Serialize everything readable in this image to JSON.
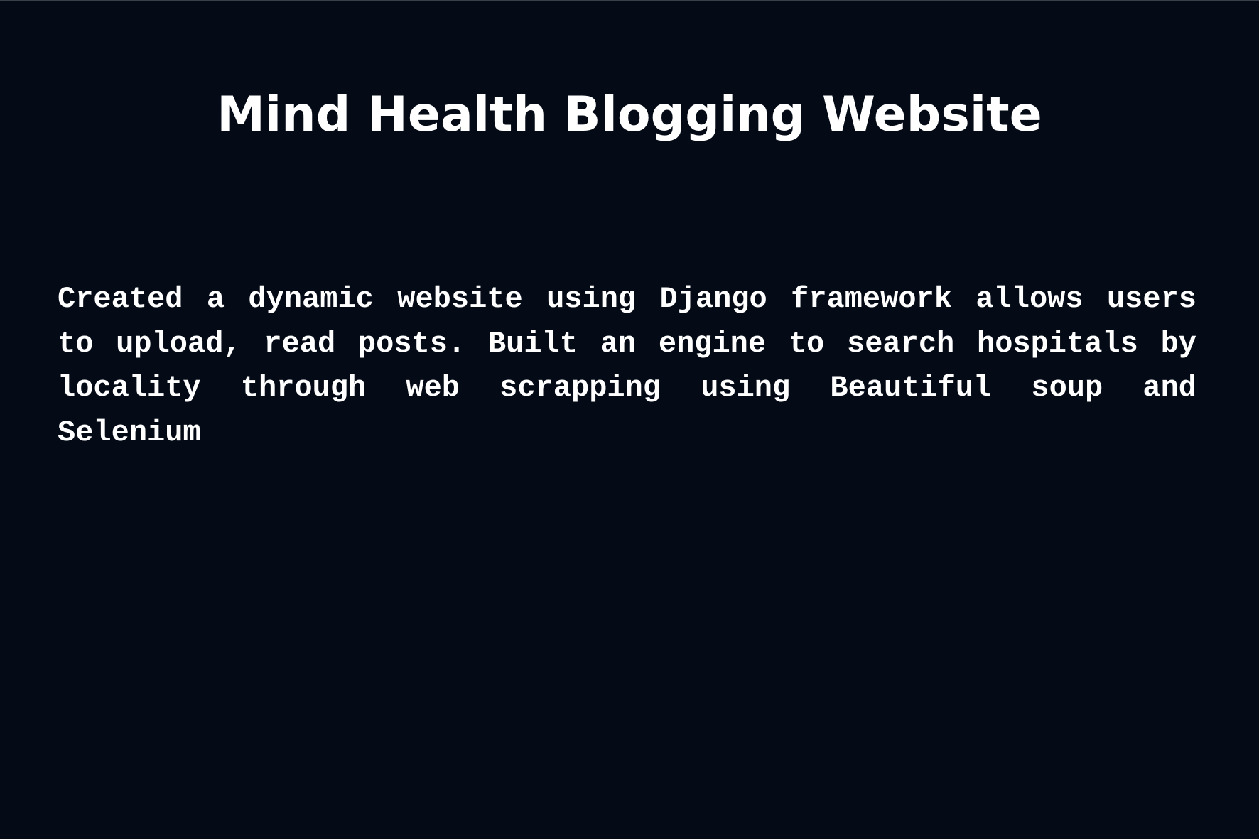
{
  "title": "Mind Health Blogging Website",
  "description": "Created a dynamic website using Django framework allows users to upload, read posts. Built an engine to search hospitals by locality through web scrapping using Beautiful soup and Selenium",
  "colors": {
    "background": "#050b16",
    "text": "#ffffff"
  }
}
